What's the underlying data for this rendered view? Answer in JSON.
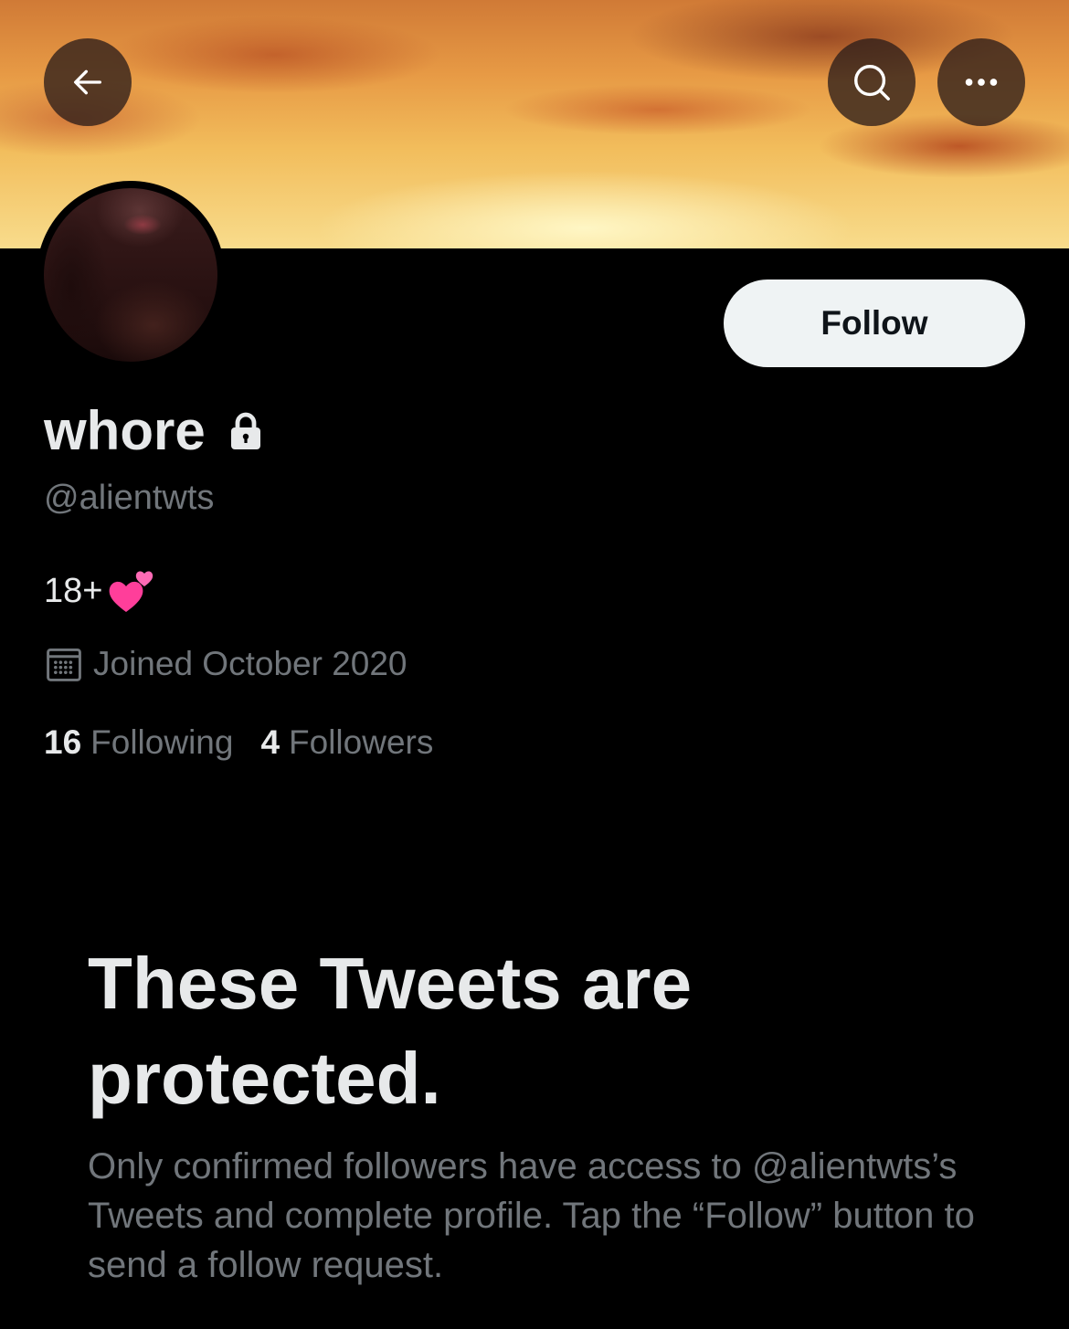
{
  "header": {
    "back_icon": "arrow-left-icon",
    "search_icon": "search-icon",
    "more_icon": "more-horizontal-icon"
  },
  "profile": {
    "display_name": "whore",
    "handle": "@alientwts",
    "bio": "18+",
    "bio_emoji": "two-hearts-emoji",
    "joined": "Joined October 2020",
    "following_count": "16",
    "following_label": "Following",
    "followers_count": "4",
    "followers_label": "Followers"
  },
  "actions": {
    "follow_label": "Follow"
  },
  "protected": {
    "title": "These Tweets are protected.",
    "body": "Only confirmed followers have access to @alientwts’s Tweets and complete profile. Tap the “Follow” button to send a follow request."
  },
  "colors": {
    "background": "#000000",
    "primary_text": "#e7e9ea",
    "secondary_text": "#71767b",
    "follow_button_bg": "#eff3f4",
    "heart_pink": "#ff3e9a"
  }
}
